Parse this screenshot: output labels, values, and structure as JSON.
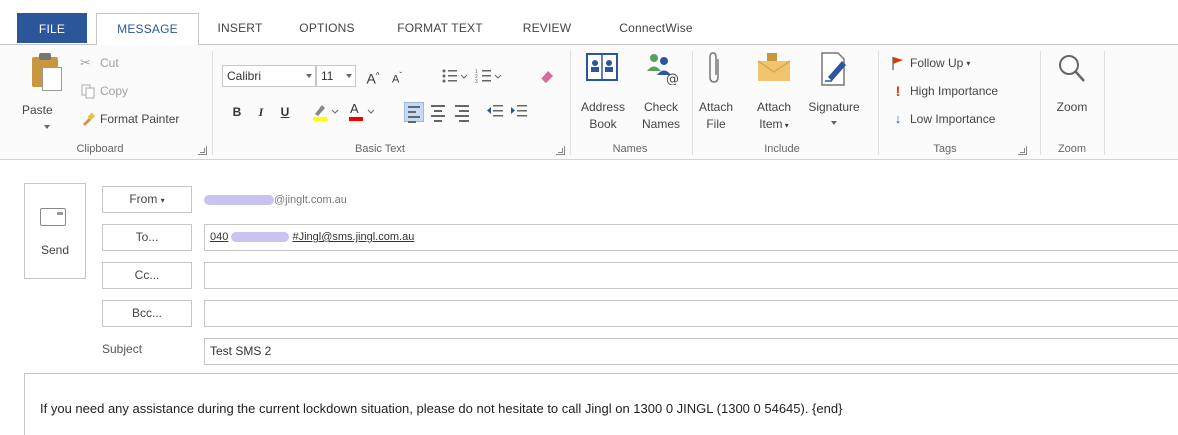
{
  "tabs": {
    "file": "FILE",
    "message": "MESSAGE",
    "insert": "INSERT",
    "options": "OPTIONS",
    "format_text": "FORMAT TEXT",
    "review": "REVIEW",
    "connectwise": "ConnectWise"
  },
  "ribbon": {
    "clipboard": {
      "label": "Clipboard",
      "paste": "Paste",
      "cut": "Cut",
      "copy": "Copy",
      "format_painter": "Format Painter"
    },
    "basic_text": {
      "label": "Basic Text",
      "font_name": "Calibri",
      "font_size": "11",
      "grow_font": "A",
      "shrink_font": "A",
      "bold": "B",
      "italic": "I",
      "underline": "U",
      "font_color": "A"
    },
    "names": {
      "label": "Names",
      "address_book_line1": "Address",
      "address_book_line2": "Book",
      "check_names_line1": "Check",
      "check_names_line2": "Names"
    },
    "include": {
      "label": "Include",
      "attach_file_line1": "Attach",
      "attach_file_line2": "File",
      "attach_item_line1": "Attach",
      "attach_item_line2": "Item",
      "signature": "Signature"
    },
    "tags": {
      "label": "Tags",
      "follow_up": "Follow Up",
      "high_importance": "High Importance",
      "low_importance": "Low Importance"
    },
    "zoom": {
      "label": "Zoom",
      "zoom": "Zoom"
    }
  },
  "compose": {
    "send": "Send",
    "from_button": "From",
    "from_value": "@jinglt.com.au",
    "to_button": "To...",
    "to_value_prefix": "040",
    "to_value_suffix": "#Jingl@sms.jingl.com.au",
    "cc_button": "Cc...",
    "bcc_button": "Bcc...",
    "subject_label": "Subject",
    "subject_value": "Test SMS 2",
    "body": "If you need any assistance during the current lockdown situation, please do not hesitate to call Jingl on 1300 0 JINGL (1300 0 54645). {end}"
  },
  "colors": {
    "file_tab": "#2b579a",
    "active_tab_text": "#2b579a",
    "high_importance": "#d83b01",
    "low_importance": "#2b579a",
    "redaction": "#c8c3f0"
  }
}
